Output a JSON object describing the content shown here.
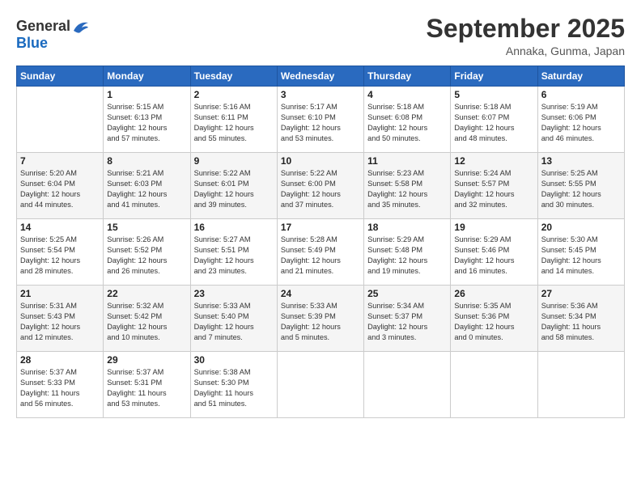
{
  "logo": {
    "general": "General",
    "blue": "Blue"
  },
  "title": "September 2025",
  "location": "Annaka, Gunma, Japan",
  "days_header": [
    "Sunday",
    "Monday",
    "Tuesday",
    "Wednesday",
    "Thursday",
    "Friday",
    "Saturday"
  ],
  "weeks": [
    [
      {
        "day": "",
        "info": ""
      },
      {
        "day": "1",
        "info": "Sunrise: 5:15 AM\nSunset: 6:13 PM\nDaylight: 12 hours\nand 57 minutes."
      },
      {
        "day": "2",
        "info": "Sunrise: 5:16 AM\nSunset: 6:11 PM\nDaylight: 12 hours\nand 55 minutes."
      },
      {
        "day": "3",
        "info": "Sunrise: 5:17 AM\nSunset: 6:10 PM\nDaylight: 12 hours\nand 53 minutes."
      },
      {
        "day": "4",
        "info": "Sunrise: 5:18 AM\nSunset: 6:08 PM\nDaylight: 12 hours\nand 50 minutes."
      },
      {
        "day": "5",
        "info": "Sunrise: 5:18 AM\nSunset: 6:07 PM\nDaylight: 12 hours\nand 48 minutes."
      },
      {
        "day": "6",
        "info": "Sunrise: 5:19 AM\nSunset: 6:06 PM\nDaylight: 12 hours\nand 46 minutes."
      }
    ],
    [
      {
        "day": "7",
        "info": "Sunrise: 5:20 AM\nSunset: 6:04 PM\nDaylight: 12 hours\nand 44 minutes."
      },
      {
        "day": "8",
        "info": "Sunrise: 5:21 AM\nSunset: 6:03 PM\nDaylight: 12 hours\nand 41 minutes."
      },
      {
        "day": "9",
        "info": "Sunrise: 5:22 AM\nSunset: 6:01 PM\nDaylight: 12 hours\nand 39 minutes."
      },
      {
        "day": "10",
        "info": "Sunrise: 5:22 AM\nSunset: 6:00 PM\nDaylight: 12 hours\nand 37 minutes."
      },
      {
        "day": "11",
        "info": "Sunrise: 5:23 AM\nSunset: 5:58 PM\nDaylight: 12 hours\nand 35 minutes."
      },
      {
        "day": "12",
        "info": "Sunrise: 5:24 AM\nSunset: 5:57 PM\nDaylight: 12 hours\nand 32 minutes."
      },
      {
        "day": "13",
        "info": "Sunrise: 5:25 AM\nSunset: 5:55 PM\nDaylight: 12 hours\nand 30 minutes."
      }
    ],
    [
      {
        "day": "14",
        "info": "Sunrise: 5:25 AM\nSunset: 5:54 PM\nDaylight: 12 hours\nand 28 minutes."
      },
      {
        "day": "15",
        "info": "Sunrise: 5:26 AM\nSunset: 5:52 PM\nDaylight: 12 hours\nand 26 minutes."
      },
      {
        "day": "16",
        "info": "Sunrise: 5:27 AM\nSunset: 5:51 PM\nDaylight: 12 hours\nand 23 minutes."
      },
      {
        "day": "17",
        "info": "Sunrise: 5:28 AM\nSunset: 5:49 PM\nDaylight: 12 hours\nand 21 minutes."
      },
      {
        "day": "18",
        "info": "Sunrise: 5:29 AM\nSunset: 5:48 PM\nDaylight: 12 hours\nand 19 minutes."
      },
      {
        "day": "19",
        "info": "Sunrise: 5:29 AM\nSunset: 5:46 PM\nDaylight: 12 hours\nand 16 minutes."
      },
      {
        "day": "20",
        "info": "Sunrise: 5:30 AM\nSunset: 5:45 PM\nDaylight: 12 hours\nand 14 minutes."
      }
    ],
    [
      {
        "day": "21",
        "info": "Sunrise: 5:31 AM\nSunset: 5:43 PM\nDaylight: 12 hours\nand 12 minutes."
      },
      {
        "day": "22",
        "info": "Sunrise: 5:32 AM\nSunset: 5:42 PM\nDaylight: 12 hours\nand 10 minutes."
      },
      {
        "day": "23",
        "info": "Sunrise: 5:33 AM\nSunset: 5:40 PM\nDaylight: 12 hours\nand 7 minutes."
      },
      {
        "day": "24",
        "info": "Sunrise: 5:33 AM\nSunset: 5:39 PM\nDaylight: 12 hours\nand 5 minutes."
      },
      {
        "day": "25",
        "info": "Sunrise: 5:34 AM\nSunset: 5:37 PM\nDaylight: 12 hours\nand 3 minutes."
      },
      {
        "day": "26",
        "info": "Sunrise: 5:35 AM\nSunset: 5:36 PM\nDaylight: 12 hours\nand 0 minutes."
      },
      {
        "day": "27",
        "info": "Sunrise: 5:36 AM\nSunset: 5:34 PM\nDaylight: 11 hours\nand 58 minutes."
      }
    ],
    [
      {
        "day": "28",
        "info": "Sunrise: 5:37 AM\nSunset: 5:33 PM\nDaylight: 11 hours\nand 56 minutes."
      },
      {
        "day": "29",
        "info": "Sunrise: 5:37 AM\nSunset: 5:31 PM\nDaylight: 11 hours\nand 53 minutes."
      },
      {
        "day": "30",
        "info": "Sunrise: 5:38 AM\nSunset: 5:30 PM\nDaylight: 11 hours\nand 51 minutes."
      },
      {
        "day": "",
        "info": ""
      },
      {
        "day": "",
        "info": ""
      },
      {
        "day": "",
        "info": ""
      },
      {
        "day": "",
        "info": ""
      }
    ]
  ]
}
